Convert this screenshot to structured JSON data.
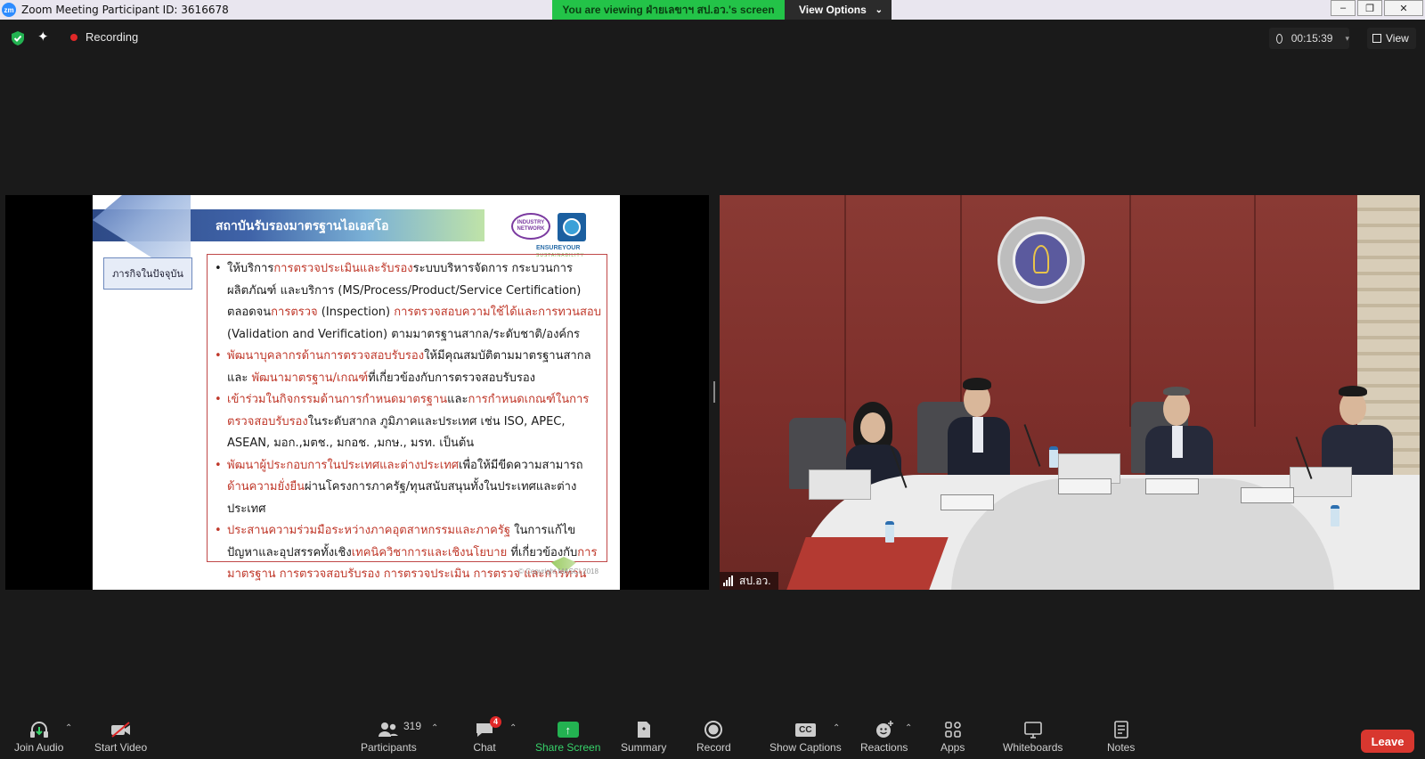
{
  "window": {
    "title": "Zoom Meeting Participant ID: 3616678",
    "logo_text": "zm",
    "viewing_banner": "You are viewing ฝ่ายเลขาฯ สป.อว.'s screen",
    "view_options_label": "View Options"
  },
  "topbar": {
    "recording_label": "Recording",
    "timer": "00:15:39",
    "view_label": "View"
  },
  "slide": {
    "title": "สถาบันรับรองมาตรฐานไอเอสโอ",
    "logo1_text": "INDUSTRY NETWORK",
    "ensure_text": "ENSUREYOUR",
    "sustainability_text": "SUSTAINABILITY",
    "side_label": "ภารกิจในปัจจุบัน",
    "copyright": "© Copyright MASCI 2018",
    "bullets": [
      {
        "segments": [
          {
            "text": "ให้บริการ",
            "red": false
          },
          {
            "text": "การตรวจประเมินและรับรอง",
            "red": true
          },
          {
            "text": "ระบบบริหารจัดการ กระบวนการ ผลิตภัณฑ์ และบริการ (MS/Process/Product/Service Certification) ตลอดจน",
            "red": false
          },
          {
            "text": "การตรวจ",
            "red": true
          },
          {
            "text": " (Inspection) ",
            "red": false
          },
          {
            "text": "การตรวจสอบความใช้ได้และการทวนสอบ",
            "red": true
          },
          {
            "text": " (Validation and Verification) ตามมาตรฐานสากล/ระดับชาติ/องค์กร",
            "red": false
          }
        ],
        "red_bullet": false
      },
      {
        "segments": [
          {
            "text": "พัฒนาบุคลากรด้านการตรวจสอบรับรอง",
            "red": true
          },
          {
            "text": "ให้มีคุณสมบัติตามมาตรฐานสากล และ ",
            "red": false
          },
          {
            "text": "พัฒนามาตรฐาน/เกณฑ์",
            "red": true
          },
          {
            "text": "ที่เกี่ยวข้องกับการตรวจสอบรับรอง",
            "red": false
          }
        ],
        "red_bullet": true
      },
      {
        "segments": [
          {
            "text": "เข้าร่วมในกิจกรรมด้านการกำหนดมาตรฐาน",
            "red": true
          },
          {
            "text": "และ",
            "red": false
          },
          {
            "text": "การกำหนดเกณฑ์ในการตรวจสอบรับรอง",
            "red": true
          },
          {
            "text": "ในระดับสากล ภูมิภาคและประเทศ เช่น ISO, APEC, ASEAN, มอก.,มตช., มกอช. ,มกษ., มรท. เป็นต้น",
            "red": false
          }
        ],
        "red_bullet": true
      },
      {
        "segments": [
          {
            "text": "พัฒนาผู้ประกอบการในประเทศและต่างประเทศ",
            "red": true
          },
          {
            "text": "เพื่อให้มีขีดความสามารถ",
            "red": false
          },
          {
            "text": "ด้านความยั่งยืน",
            "red": true
          },
          {
            "text": "ผ่านโครงการภาครัฐ/ทุนสนับสนุนทั้งในประเทศและต่างประเทศ",
            "red": false
          }
        ],
        "red_bullet": true
      },
      {
        "segments": [
          {
            "text": "ประสานความร่วมมือระหว่างภาคอุตสาหกรรมและภาครัฐ",
            "red": true
          },
          {
            "text": " ในการแก้ไขปัญหาและอุปสรรคทั้งเชิง",
            "red": false
          },
          {
            "text": "เทคนิควิชาการและเชิงนโยบาย",
            "red": true
          },
          {
            "text": " ที่เกี่ยวข้องกับ",
            "red": false
          },
          {
            "text": "การมาตรฐาน การตรวจสอบรับรอง การตรวจประเมิน การตรวจ และการทวนสอบ",
            "red": true
          }
        ],
        "red_bullet": true
      }
    ]
  },
  "video": {
    "participant_name": "สป.อว."
  },
  "toolbar": {
    "join_audio": "Join Audio",
    "start_video": "Start Video",
    "participants": "Participants",
    "participants_count": "319",
    "chat": "Chat",
    "chat_badge": "4",
    "share_screen": "Share Screen",
    "summary": "Summary",
    "record": "Record",
    "show_captions": "Show Captions",
    "cc_icon_text": "CC",
    "reactions": "Reactions",
    "apps": "Apps",
    "whiteboards": "Whiteboards",
    "notes": "Notes",
    "leave": "Leave"
  },
  "colors": {
    "share_green": "#23b251",
    "leave_red": "#d8372f",
    "slide_red_text": "#c0392b"
  }
}
